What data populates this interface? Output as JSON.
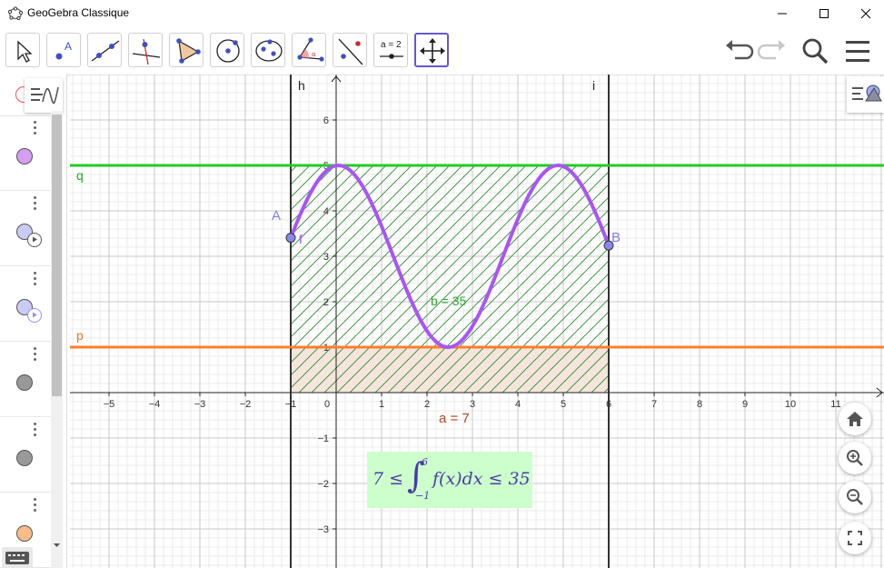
{
  "window": {
    "title": "GeoGebra Classique"
  },
  "toolbar": {
    "tools": [
      "move",
      "point",
      "line",
      "perpendicular-line",
      "polygon",
      "circle-center-point",
      "ellipse",
      "angle",
      "reflect",
      "slider",
      "move-graphics-view"
    ],
    "slider_tool_text": "a = 2",
    "active_tool": "move-graphics-view"
  },
  "algebra": {
    "items": [
      {
        "color": "#d59ef2",
        "has_play": false
      },
      {
        "color": "#c8ccf5",
        "has_play": true
      },
      {
        "color": "#c8ccf5",
        "has_play": true
      },
      {
        "color": "#999999",
        "has_play": false
      },
      {
        "color": "#999999",
        "has_play": false
      },
      {
        "color": "#f8bb8a",
        "has_play": false
      }
    ]
  },
  "graph": {
    "x_ticks": [
      "−5",
      "−4",
      "−3",
      "−2",
      "−1",
      "0",
      "1",
      "2",
      "3",
      "4",
      "5",
      "6",
      "7",
      "8",
      "9",
      "10",
      "11"
    ],
    "y_ticks": [
      "−3",
      "−2",
      "−1",
      "1",
      "2",
      "3",
      "4",
      "5",
      "6"
    ],
    "line_h_label": "h",
    "line_i_label": "i",
    "line_q_label": "q",
    "line_p_label": "p",
    "point_A_label": "A",
    "point_B_label": "B",
    "function_label": "f",
    "label_b": "b = 35",
    "label_a": "a = 7",
    "formula": {
      "lower_bound_text": "7 ≤",
      "integral_sign": "∫",
      "upper_limit": "6",
      "lower_limit": "−1",
      "integrand": "f(x)dx ≤ 35"
    },
    "colors": {
      "function": "#a855f7",
      "line_q": "#22cc22",
      "line_p": "#ff7f2a",
      "vertical_lines": "#333333",
      "hatch": "#2e8b2e",
      "lower_fill": "#f5e5dc",
      "points": "#8888ee"
    }
  }
}
